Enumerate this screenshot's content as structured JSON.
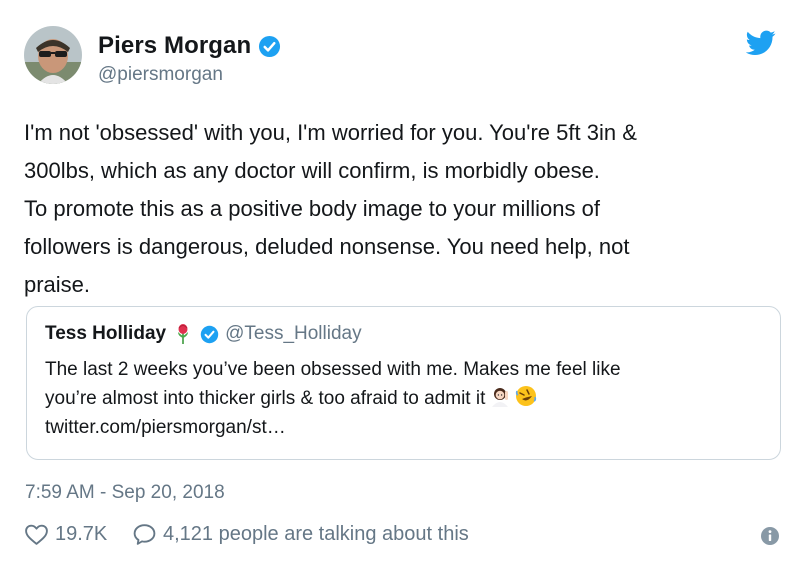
{
  "author": {
    "name": "Piers Morgan",
    "handle": "@piersmorgan"
  },
  "tweet": {
    "lines": [
      "I'm not 'obsessed' with you, I'm worried for you. You're 5ft 3in &",
      "300lbs, which as any doctor will confirm, is morbidly obese.",
      "To promote this as a positive body image to your millions of",
      "followers is dangerous, deluded nonsense. You need help, not",
      "praise."
    ]
  },
  "quoted_tweet": {
    "name": "Tess Holliday",
    "handle": "@Tess_Holliday",
    "lines": [
      "The last 2 weeks you’ve been obsessed with me. Makes me feel like",
      "you’re almost into thicker girls & too afraid to admit it",
      "twitter.com/piersmorgan/st…"
    ],
    "emojis": [
      "woman-raising-hand",
      "rolling-on-floor-laughing"
    ]
  },
  "timestamp": "7:59 AM - Sep 20, 2018",
  "stats": {
    "likes": "19.7K",
    "talking": "4,121 people are talking about this"
  },
  "colors": {
    "twitter_blue": "#1da1f2",
    "text": "#14171a",
    "secondary": "#657786",
    "border": "#ccd6dd"
  },
  "icons": {
    "verified": "verified-badge-icon",
    "bird": "twitter-bird-icon",
    "like": "heart-icon",
    "reply": "speech-bubble-icon",
    "info": "info-icon"
  }
}
